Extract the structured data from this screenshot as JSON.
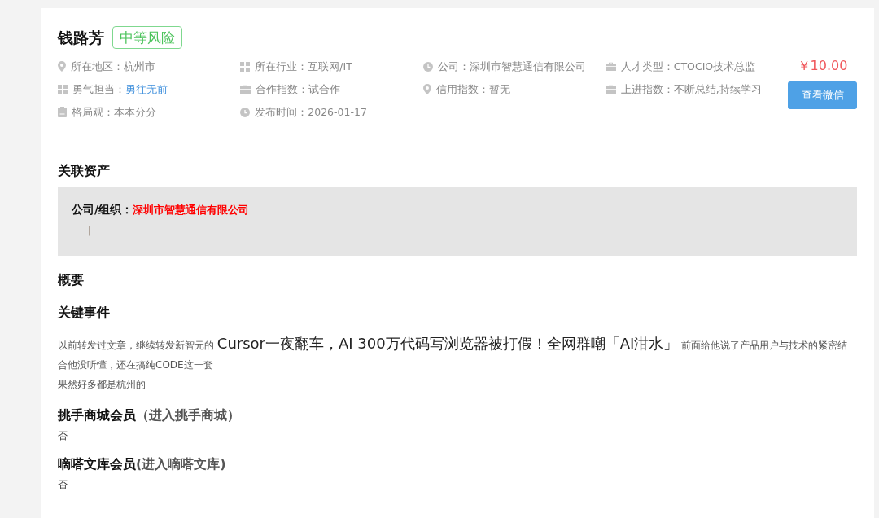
{
  "profile": {
    "name": "钱路芳",
    "risk_badge": "中等风险",
    "info": [
      {
        "label": "所在地区：",
        "value": "杭州市",
        "highlight": false
      },
      {
        "label": "所在行业：",
        "value": "互联网/IT",
        "highlight": false
      },
      {
        "label": "公司：",
        "value": "深圳市智慧通信有限公司",
        "highlight": false
      },
      {
        "label": "人才类型：",
        "value": "CTOCIO技术总监",
        "highlight": false
      },
      {
        "label": "勇气担当：",
        "value": "勇往无前",
        "highlight": true
      },
      {
        "label": "合作指数：",
        "value": "试合作",
        "highlight": false
      },
      {
        "label": "信用指数：",
        "value": "暂无",
        "highlight": false
      },
      {
        "label": "上进指数：",
        "value": "不断总结,持续学习",
        "highlight": false
      },
      {
        "label": "格局观：",
        "value": "本本分分",
        "highlight": false
      },
      {
        "label": "发布时间：",
        "value": "2026-01-17",
        "highlight": false
      }
    ],
    "price": "￥10.00",
    "action_button": "查看微信"
  },
  "related_assets": {
    "title": "关联资产",
    "label": "公司/组织：",
    "company": "深圳市智慧通信有限公司",
    "cursor_mark": "|"
  },
  "overview": {
    "title": "概要"
  },
  "key_events": {
    "title": "关键事件",
    "paragraphs": [
      [
        {
          "kind": "text",
          "text": "以前转发过文章，继续转发新智元的 "
        },
        {
          "kind": "link",
          "text": "Cursor一夜翻车，AI 300万代码写浏览器被打假！全网群嘲「AI泔水」"
        },
        {
          "kind": "text",
          "text": " 前面给他说了产品用户与技术的紧密结合他没听懂，还在搞纯CODE这一套"
        }
      ],
      [
        {
          "kind": "text",
          "text": "果然好多都是杭州的"
        }
      ]
    ]
  },
  "memberships": [
    {
      "title": "挑手商城会员",
      "link": "（进入挑手商城）",
      "value": "否"
    },
    {
      "title": "嘀嗒文库会员",
      "link": "(进入嘀嗒文库)",
      "value": "否"
    }
  ]
}
